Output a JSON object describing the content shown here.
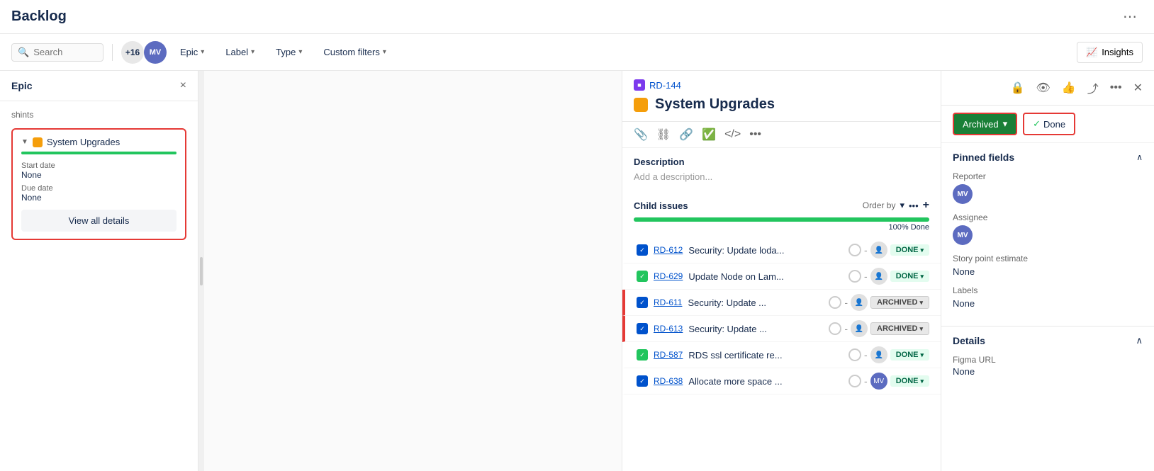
{
  "header": {
    "title": "Backlog",
    "more_label": "⋯"
  },
  "toolbar": {
    "search_placeholder": "Search",
    "avatar_count": "+16",
    "filters": [
      {
        "label": "Epic",
        "id": "epic"
      },
      {
        "label": "Label",
        "id": "label"
      },
      {
        "label": "Type",
        "id": "type"
      },
      {
        "label": "Custom filters",
        "id": "custom-filters"
      }
    ],
    "insights_label": "Insights"
  },
  "epic_panel": {
    "title": "Epic",
    "close_label": "×",
    "scroll_hint": "shints",
    "epic_item": {
      "name": "System Upgrades",
      "progress": 100,
      "start_date_label": "Start date",
      "start_date_value": "None",
      "due_date_label": "Due date",
      "due_date_value": "None",
      "view_all_label": "View all details"
    }
  },
  "issue_detail": {
    "issue_id": "RD-144",
    "issue_title": "System Upgrades",
    "description_label": "Description",
    "description_placeholder": "Add a description...",
    "child_issues_label": "Child issues",
    "order_by_label": "Order by",
    "progress_percent": "100% Done",
    "children": [
      {
        "id": "RD-612",
        "title": "Security: Update loda...",
        "status": "DONE",
        "status_type": "done",
        "has_check": true,
        "check_color": "blue"
      },
      {
        "id": "RD-629",
        "title": "Update Node on Lam...",
        "status": "DONE",
        "status_type": "done",
        "has_check": true,
        "check_color": "green"
      },
      {
        "id": "RD-611",
        "title": "Security: Update ...",
        "status": "ARCHIVED",
        "status_type": "archived",
        "has_check": true,
        "check_color": "blue"
      },
      {
        "id": "RD-613",
        "title": "Security: Update ...",
        "status": "ARCHIVED",
        "status_type": "archived",
        "has_check": true,
        "check_color": "blue"
      },
      {
        "id": "RD-587",
        "title": "RDS ssl certificate re...",
        "status": "DONE",
        "status_type": "done",
        "has_check": true,
        "check_color": "green"
      },
      {
        "id": "RD-638",
        "title": "Allocate more space ...",
        "status": "DONE",
        "status_type": "done",
        "has_check": true,
        "check_color": "blue",
        "avatar": "MV"
      }
    ]
  },
  "right_sidebar": {
    "archived_label": "Archived",
    "done_label": "Done",
    "pinned_fields_label": "Pinned fields",
    "reporter_label": "Reporter",
    "reporter_avatar": "MV",
    "assignee_label": "Assignee",
    "assignee_avatar": "MV",
    "story_point_label": "Story point estimate",
    "story_point_value": "None",
    "labels_label": "Labels",
    "labels_value": "None",
    "details_label": "Details",
    "figma_url_label": "Figma URL",
    "figma_url_value": "None"
  },
  "colors": {
    "accent_green": "#22c55e",
    "accent_blue": "#0052cc",
    "archived_bg": "#1a7f37",
    "red_border": "#e53935"
  }
}
